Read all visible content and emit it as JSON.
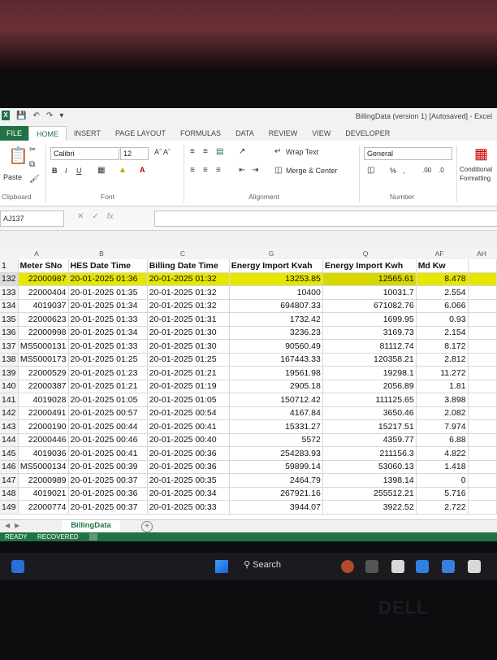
{
  "app": {
    "title": "BillingData (version 1) [Autosaved] - Excel"
  },
  "ribbon_tabs": [
    "FILE",
    "HOME",
    "INSERT",
    "PAGE LAYOUT",
    "FORMULAS",
    "DATA",
    "REVIEW",
    "VIEW",
    "DEVELOPER"
  ],
  "ribbon": {
    "font_name": "Calibri",
    "font_size": "12",
    "wrap_text": "Wrap Text",
    "merge_center": "Merge & Center",
    "number_format": "General",
    "conditional_formatting": "Conditional Formatting",
    "paste": "Paste",
    "group_clipboard": "Clipboard",
    "group_font": "Font",
    "group_alignment": "Alignment",
    "group_number": "Number"
  },
  "formula_bar": {
    "name_box": "AJ137",
    "fx": "fx"
  },
  "columns": [
    "A",
    "B",
    "C",
    "G",
    "Q",
    "AF",
    "AH"
  ],
  "header_row": {
    "row_num": "1",
    "cells": [
      "Meter SNo",
      "HES Date Time",
      "Billing Date Time",
      "Energy Import Kvah",
      "Energy Import Kwh",
      "Md Kw"
    ]
  },
  "rows": [
    {
      "n": "132",
      "c": [
        "22000987",
        "20-01-2025 01:36",
        "20-01-2025 01:32",
        "13253.85",
        "12565.61",
        "8.478"
      ]
    },
    {
      "n": "133",
      "c": [
        "22000404",
        "20-01-2025 01:35",
        "20-01-2025 01:32",
        "10400",
        "10031.7",
        "2.554"
      ]
    },
    {
      "n": "134",
      "c": [
        "4019037",
        "20-01-2025 01:34",
        "20-01-2025 01:32",
        "694807.33",
        "671082.76",
        "6.066"
      ]
    },
    {
      "n": "135",
      "c": [
        "22000623",
        "20-01-2025 01:33",
        "20-01-2025 01:31",
        "1732.42",
        "1699.95",
        "0.93"
      ]
    },
    {
      "n": "136",
      "c": [
        "22000998",
        "20-01-2025 01:34",
        "20-01-2025 01:30",
        "3236.23",
        "3169.73",
        "2.154"
      ]
    },
    {
      "n": "137",
      "c": [
        "MS5000131",
        "20-01-2025 01:33",
        "20-01-2025 01:30",
        "90560.49",
        "81112.74",
        "8.172"
      ]
    },
    {
      "n": "138",
      "c": [
        "MS5000173",
        "20-01-2025 01:25",
        "20-01-2025 01:25",
        "167443.33",
        "120358.21",
        "2.812"
      ]
    },
    {
      "n": "139",
      "c": [
        "22000529",
        "20-01-2025 01:23",
        "20-01-2025 01:21",
        "19561.98",
        "19298.1",
        "11.272"
      ]
    },
    {
      "n": "140",
      "c": [
        "22000387",
        "20-01-2025 01:21",
        "20-01-2025 01:19",
        "2905.18",
        "2056.89",
        "1.81"
      ]
    },
    {
      "n": "141",
      "c": [
        "4019028",
        "20-01-2025 01:05",
        "20-01-2025 01:05",
        "150712.42",
        "111125.65",
        "3.898"
      ]
    },
    {
      "n": "142",
      "c": [
        "22000491",
        "20-01-2025 00:57",
        "20-01-2025 00:54",
        "4167.84",
        "3650.46",
        "2.082"
      ]
    },
    {
      "n": "143",
      "c": [
        "22000190",
        "20-01-2025 00:44",
        "20-01-2025 00:41",
        "15331.27",
        "15217.51",
        "7.974"
      ]
    },
    {
      "n": "144",
      "c": [
        "22000446",
        "20-01-2025 00:46",
        "20-01-2025 00:40",
        "5572",
        "4359.77",
        "6.88"
      ]
    },
    {
      "n": "145",
      "c": [
        "4019036",
        "20-01-2025 00:41",
        "20-01-2025 00:36",
        "254283.93",
        "211156.3",
        "4.822"
      ]
    },
    {
      "n": "146",
      "c": [
        "MS5000134",
        "20-01-2025 00:39",
        "20-01-2025 00:36",
        "59899.14",
        "53060.13",
        "1.418"
      ]
    },
    {
      "n": "147",
      "c": [
        "22000989",
        "20-01-2025 00:37",
        "20-01-2025 00:35",
        "2464.79",
        "1398.14",
        "0"
      ]
    },
    {
      "n": "148",
      "c": [
        "4019021",
        "20-01-2025 00:36",
        "20-01-2025 00:34",
        "267921.16",
        "255512.21",
        "5.716"
      ]
    },
    {
      "n": "149",
      "c": [
        "22000774",
        "20-01-2025 00:37",
        "20-01-2025 00:33",
        "3944.07",
        "3922.52",
        "2.722"
      ]
    }
  ],
  "sheet_tab": "BillingData",
  "status": {
    "ready": "READY",
    "recovered": "RECOVERED"
  },
  "taskbar": {
    "search": "Search"
  },
  "brand": "DELL",
  "colors": {
    "excel_green": "#217346",
    "highlight_yellow": "#e6e600"
  }
}
